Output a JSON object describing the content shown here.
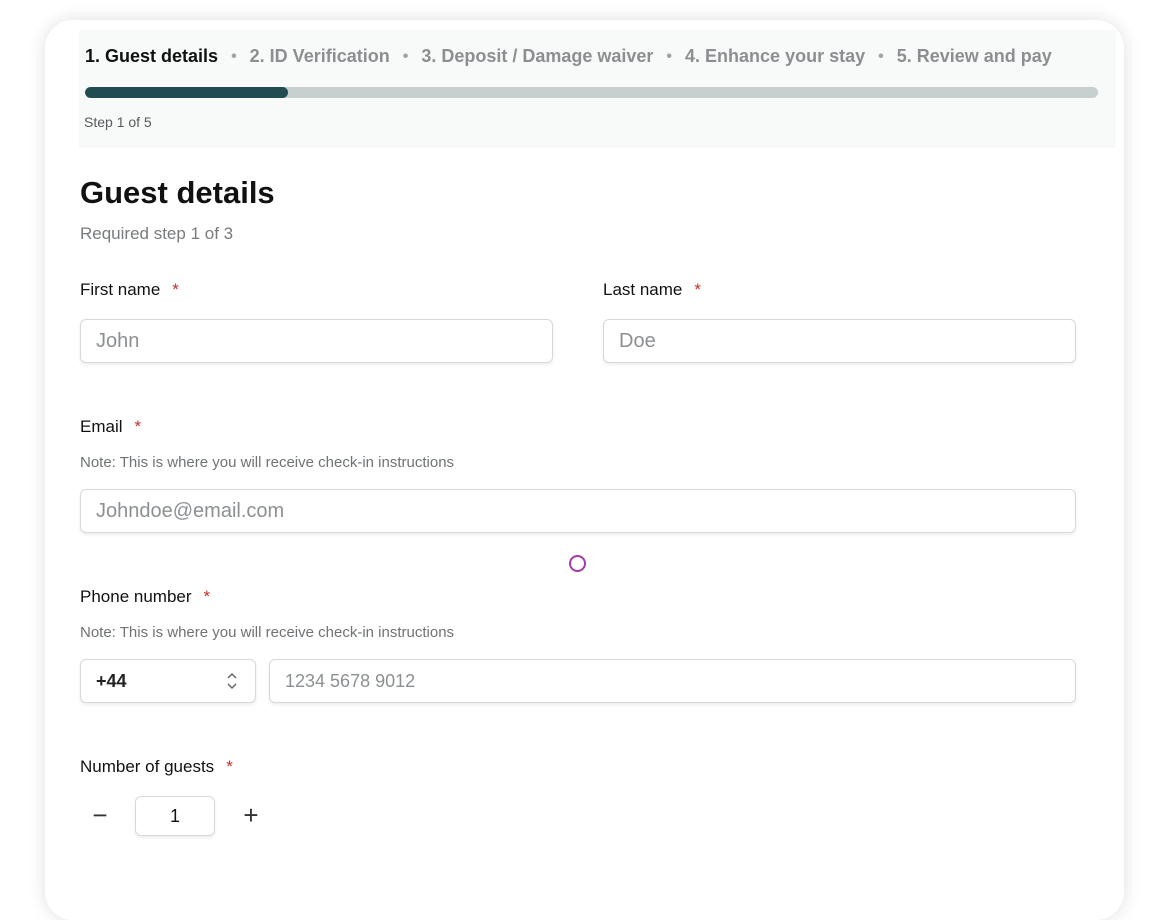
{
  "stepper": {
    "steps": [
      {
        "label": "1. Guest details",
        "active": true
      },
      {
        "label": "2. ID Verification",
        "active": false
      },
      {
        "label": "3. Deposit / Damage waiver",
        "active": false
      },
      {
        "label": "4. Enhance your stay",
        "active": false
      },
      {
        "label": "5. Review and pay",
        "active": false
      }
    ],
    "separator": "•",
    "progress_fraction": 0.2,
    "step_count": "Step 1 of 5"
  },
  "form": {
    "title": "Guest details",
    "subtitle": "Required step 1 of 3",
    "required_marker": "*",
    "first_name": {
      "label": "First name",
      "placeholder": "John"
    },
    "last_name": {
      "label": "Last name",
      "placeholder": "Doe"
    },
    "email": {
      "label": "Email",
      "note": "Note: This is where you will receive check-in instructions",
      "placeholder": "Johndoe@email.com"
    },
    "phone": {
      "label": "Phone number",
      "note": "Note: This is where you will receive check-in instructions",
      "country_code": "+44",
      "placeholder": "1234 5678 9012"
    },
    "guests": {
      "label": "Number of guests",
      "decrement": "−",
      "value": "1",
      "increment": "+"
    }
  },
  "colors": {
    "progress_fill": "#1f4d52",
    "progress_track": "#c7d0cf",
    "required": "#c2302a"
  }
}
